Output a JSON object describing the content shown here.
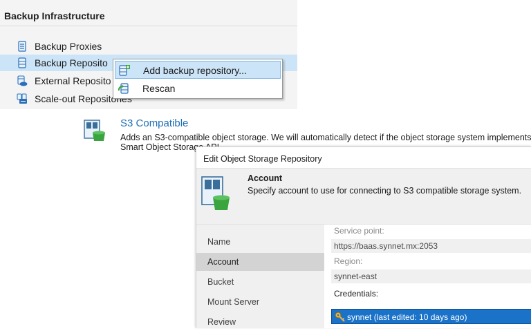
{
  "tree": {
    "header": "Backup Infrastructure",
    "items": [
      {
        "label": "Backup Proxies"
      },
      {
        "label": "Backup Reposito"
      },
      {
        "label": "External Reposito"
      },
      {
        "label": "Scale-out Repositories"
      }
    ]
  },
  "context_menu": {
    "items": [
      {
        "label": "Add backup repository..."
      },
      {
        "label": "Rescan"
      }
    ]
  },
  "s3_option": {
    "title": "S3 Compatible",
    "description": "Adds an S3-compatible object storage. We will automatically detect if the object storage system implements Smart Object Storage API."
  },
  "dialog": {
    "title": "Edit Object Storage Repository",
    "step_heading": "Account",
    "step_description": "Specify account to use for connecting to S3 compatible storage system.",
    "nav": [
      {
        "label": "Name"
      },
      {
        "label": "Account"
      },
      {
        "label": "Bucket"
      },
      {
        "label": "Mount Server"
      },
      {
        "label": "Review"
      }
    ],
    "fields": {
      "service_point_label": "Service point:",
      "service_point_value": "https://baas.synnet.mx:2053",
      "region_label": "Region:",
      "region_value": "synnet-east",
      "credentials_label": "Credentials:",
      "credentials_value": "synnet (last edited: 10 days ago)"
    }
  },
  "colors": {
    "selection": "#cce4f7",
    "accent_blue": "#1a73c9",
    "link_blue": "#1e6fb5",
    "repo_green": "#3aa43e"
  }
}
